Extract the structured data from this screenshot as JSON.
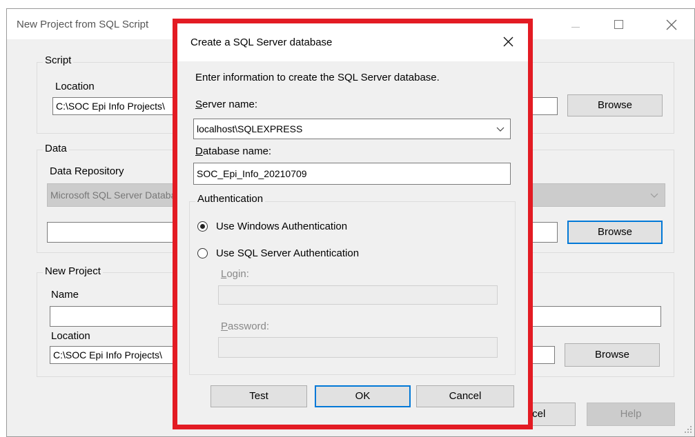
{
  "main_window": {
    "title": "New Project from SQL Script",
    "script_group": {
      "label": "Script",
      "location_label": "Location",
      "location_value": "C:\\SOC Epi Info Projects\\",
      "browse_label": "Browse"
    },
    "data_group": {
      "label": "Data",
      "repository_label": "Data Repository",
      "repository_value": "Microsoft SQL Server Database",
      "connection_value": "",
      "browse_label": "Browse"
    },
    "project_group": {
      "label": "New Project",
      "name_label": "Name",
      "name_value": "",
      "location_label": "Location",
      "location_value": "C:\\SOC Epi Info Projects\\",
      "browse_label": "Browse"
    },
    "cancel_label": "Cancel",
    "help_label": "Help"
  },
  "dialog": {
    "title": "Create a SQL Server database",
    "instruction": "Enter information to create the SQL Server database.",
    "server_label_key": "S",
    "server_label_rest": "erver name:",
    "server_value": "localhost\\SQLEXPRESS",
    "database_label_key": "D",
    "database_label_rest": "atabase name:",
    "database_value": "SOC_Epi_Info_20210709",
    "auth": {
      "label": "Authentication",
      "windows_label": "Use Windows Authentication",
      "windows_checked": true,
      "sql_label": "Use SQL Server Authentication",
      "sql_checked": false,
      "login_label_key": "L",
      "login_label_rest": "ogin:",
      "login_value": "",
      "password_label_key": "P",
      "password_label_rest": "assword:",
      "password_value": ""
    },
    "test_label": "Test",
    "ok_label": "OK",
    "cancel_label": "Cancel"
  },
  "colors": {
    "highlight_border": "#e31b23",
    "focus_blue": "#0078d7",
    "window_bg": "#f0f0f0"
  }
}
